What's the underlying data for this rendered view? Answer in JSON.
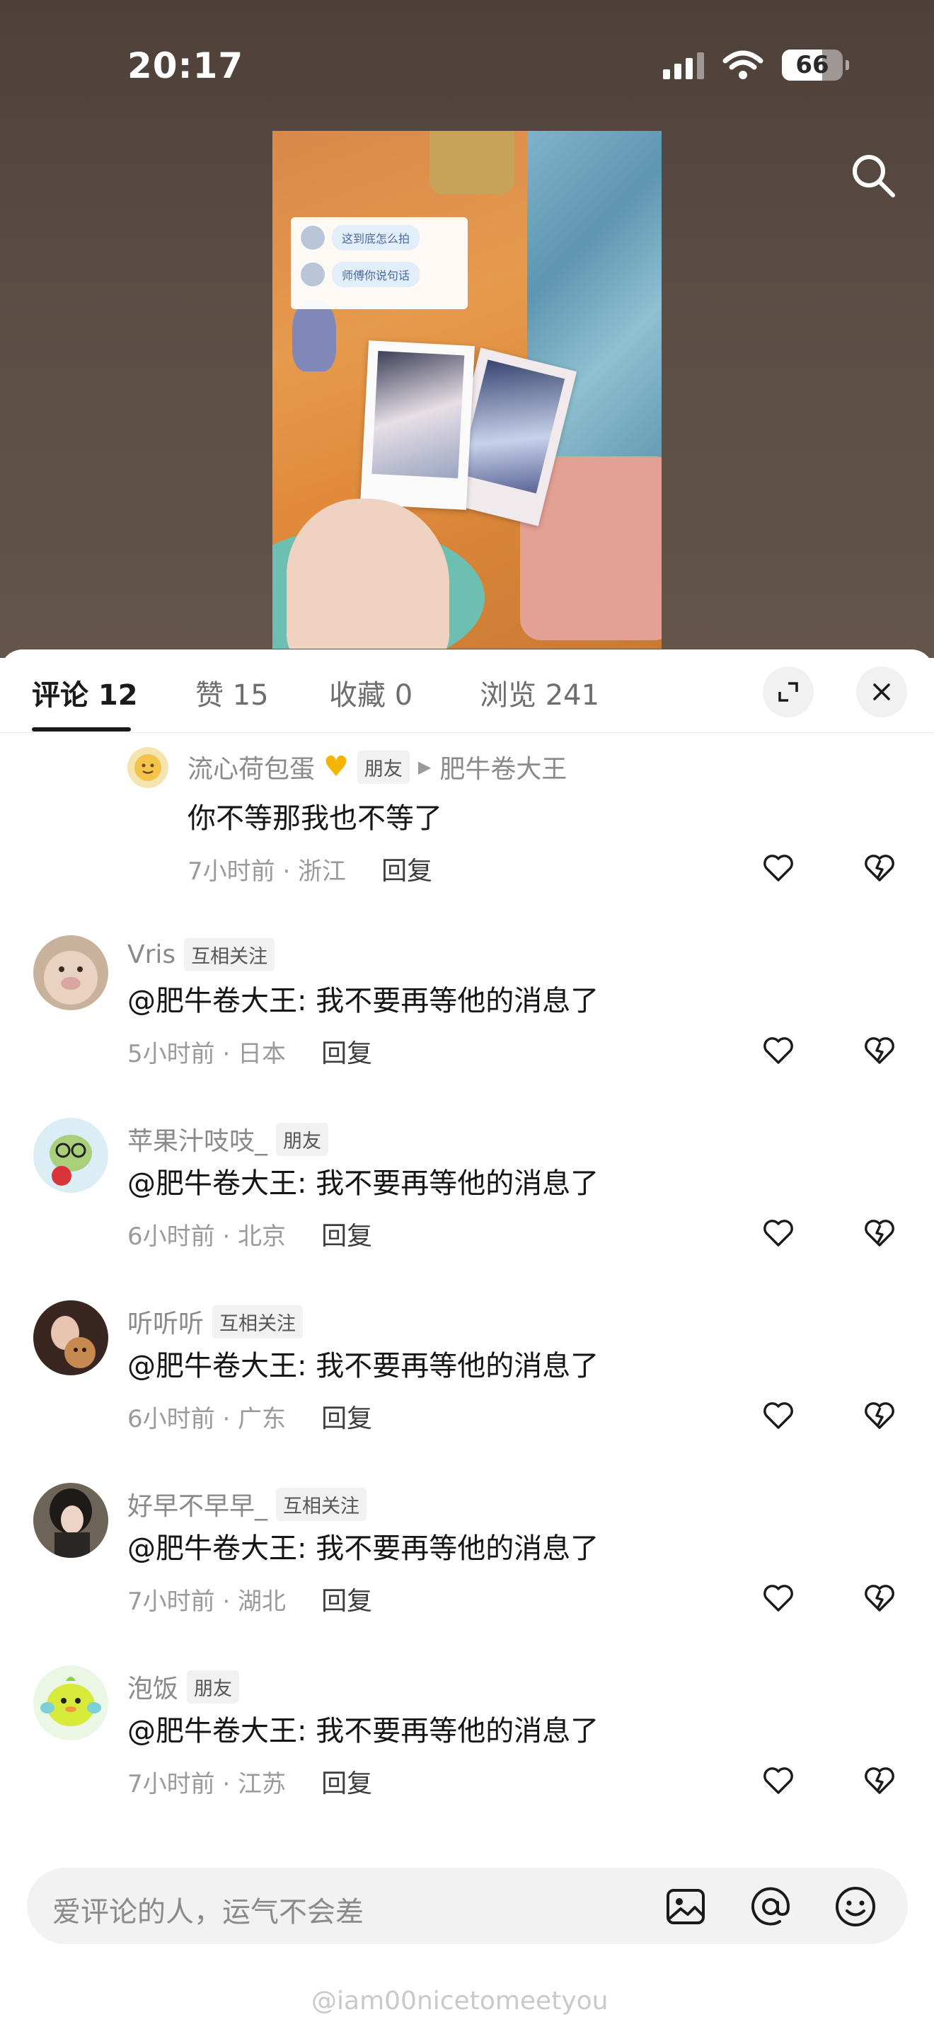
{
  "status_bar": {
    "time": "20:17",
    "battery": "66",
    "battery_level": 0.66
  },
  "tabs": [
    {
      "label": "评论 12",
      "active": true
    },
    {
      "label": "赞 15",
      "active": false
    },
    {
      "label": "收藏 0",
      "active": false
    },
    {
      "label": "浏览 241",
      "active": false
    }
  ],
  "icons": {
    "search": "search-icon",
    "expand": "expand-icon",
    "close": "close-icon",
    "like": "heart-outline-icon",
    "dislike": "broken-heart-icon",
    "image": "image-icon",
    "mention": "at-icon",
    "emoji": "emoji-icon"
  },
  "video": {
    "chat_lines": [
      "这到底怎么拍",
      "师傅你说句话"
    ]
  },
  "comments": [
    {
      "name": "流心荷包蛋",
      "badge": "朋友",
      "reply_to": "肥牛卷大王",
      "text": "你不等那我也不等了",
      "time": "7小时前 · 浙江",
      "reply": "回复",
      "nested": true
    },
    {
      "name": "Vris",
      "badge": "互相关注",
      "text": "@肥牛卷大王: 我不要再等他的消息了",
      "time": "5小时前 · 日本",
      "reply": "回复"
    },
    {
      "name": "苹果汁吱吱_",
      "badge": "朋友",
      "text": "@肥牛卷大王: 我不要再等他的消息了",
      "time": "6小时前 · 北京",
      "reply": "回复"
    },
    {
      "name": "听听听",
      "badge": "互相关注",
      "text": "@肥牛卷大王: 我不要再等他的消息了",
      "time": "6小时前 · 广东",
      "reply": "回复"
    },
    {
      "name": "好早不早早_",
      "badge": "互相关注",
      "text": "@肥牛卷大王: 我不要再等他的消息了",
      "time": "7小时前 · 湖北",
      "reply": "回复"
    },
    {
      "name": "泡饭",
      "badge": "朋友",
      "text": "@肥牛卷大王: 我不要再等他的消息了",
      "time": "7小时前 · 江苏",
      "reply": "回复"
    }
  ],
  "input": {
    "placeholder": "爱评论的人，运气不会差"
  },
  "watermark": "@iam00nicetomeetyou",
  "colors": {
    "sheet_bg": "#ffffff",
    "badge_bg": "#f1f1f1",
    "accent_text": "#151515"
  }
}
